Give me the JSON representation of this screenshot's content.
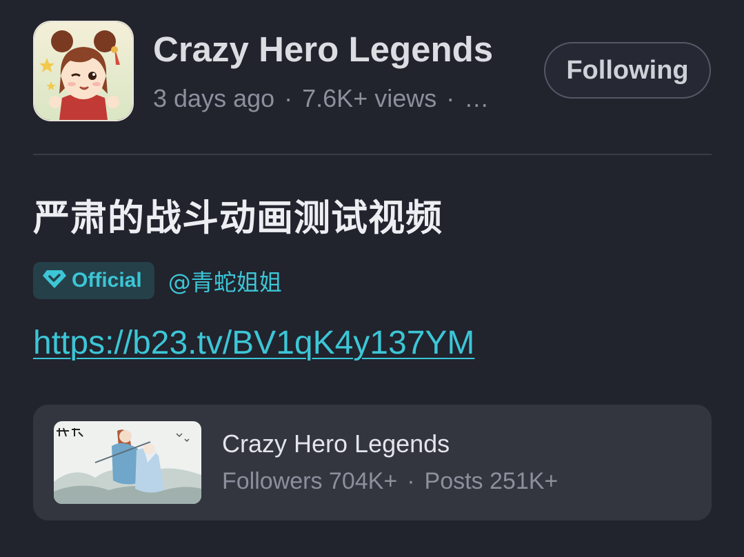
{
  "header": {
    "app_name": "Crazy Hero Legends",
    "time_ago": "3 days ago",
    "separator": "·",
    "views": "7.6K+ views",
    "more": "…",
    "follow_label": "Following"
  },
  "post": {
    "title": "严肃的战斗动画测试视频",
    "badge_label": "Official",
    "mention": "@青蛇姐姐",
    "link": "https://b23.tv/BV1qK4y137YM"
  },
  "card": {
    "title": "Crazy Hero Legends",
    "followers": "Followers 704K+",
    "separator": "·",
    "posts": "Posts 251K+"
  },
  "colors": {
    "background": "#21232d",
    "accent": "#3cc6d6",
    "card": "#33363f",
    "muted_text": "#8d909c"
  },
  "icons": {
    "badge": "diamond-check-icon",
    "app": "app-avatar-icon",
    "thumbnail": "game-thumbnail"
  }
}
